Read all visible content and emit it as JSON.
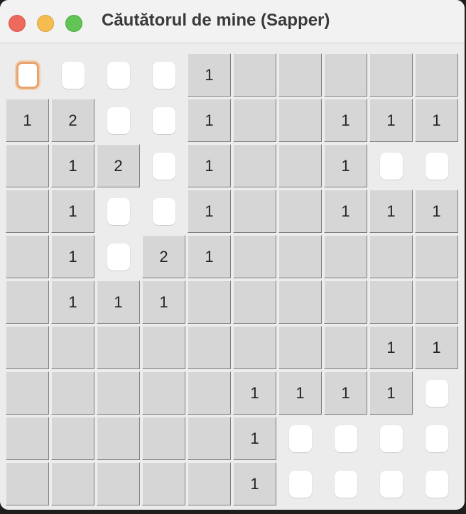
{
  "window": {
    "title": "Căutătorul de mine (Sapper)",
    "traffic_lights": [
      "close-button",
      "minimize-button",
      "maximize-button"
    ]
  },
  "board": {
    "rows": 10,
    "cols": 10,
    "legend": {
      "#": "unrevealed",
      ".": "revealed-empty",
      "1-9": "revealed-number"
    },
    "focused_cell": [
      0,
      0
    ],
    "grid": [
      [
        "#",
        "#",
        "#",
        "#",
        "1",
        ".",
        ".",
        ".",
        ".",
        "."
      ],
      [
        "1",
        "2",
        "#",
        "#",
        "1",
        ".",
        ".",
        "1",
        "1",
        "1"
      ],
      [
        ".",
        "1",
        "2",
        "#",
        "1",
        ".",
        ".",
        "1",
        "#",
        "#"
      ],
      [
        ".",
        "1",
        "#",
        "#",
        "1",
        ".",
        ".",
        "1",
        "1",
        "1"
      ],
      [
        ".",
        "1",
        "#",
        "2",
        "1",
        ".",
        ".",
        ".",
        ".",
        "."
      ],
      [
        ".",
        "1",
        "1",
        "1",
        ".",
        ".",
        ".",
        ".",
        ".",
        "."
      ],
      [
        ".",
        ".",
        ".",
        ".",
        ".",
        ".",
        ".",
        ".",
        "1",
        "1"
      ],
      [
        ".",
        ".",
        ".",
        ".",
        ".",
        "1",
        "1",
        "1",
        "1",
        "#"
      ],
      [
        ".",
        ".",
        ".",
        ".",
        ".",
        "1",
        "#",
        "#",
        "#",
        "#"
      ],
      [
        ".",
        ".",
        ".",
        ".",
        ".",
        "1",
        "#",
        "#",
        "#",
        "#"
      ]
    ]
  },
  "colors": {
    "revealed": "#d6d6d6",
    "unrevealed": "#ffffff",
    "focus_ring": "#e8a470",
    "background": "#ececec"
  }
}
